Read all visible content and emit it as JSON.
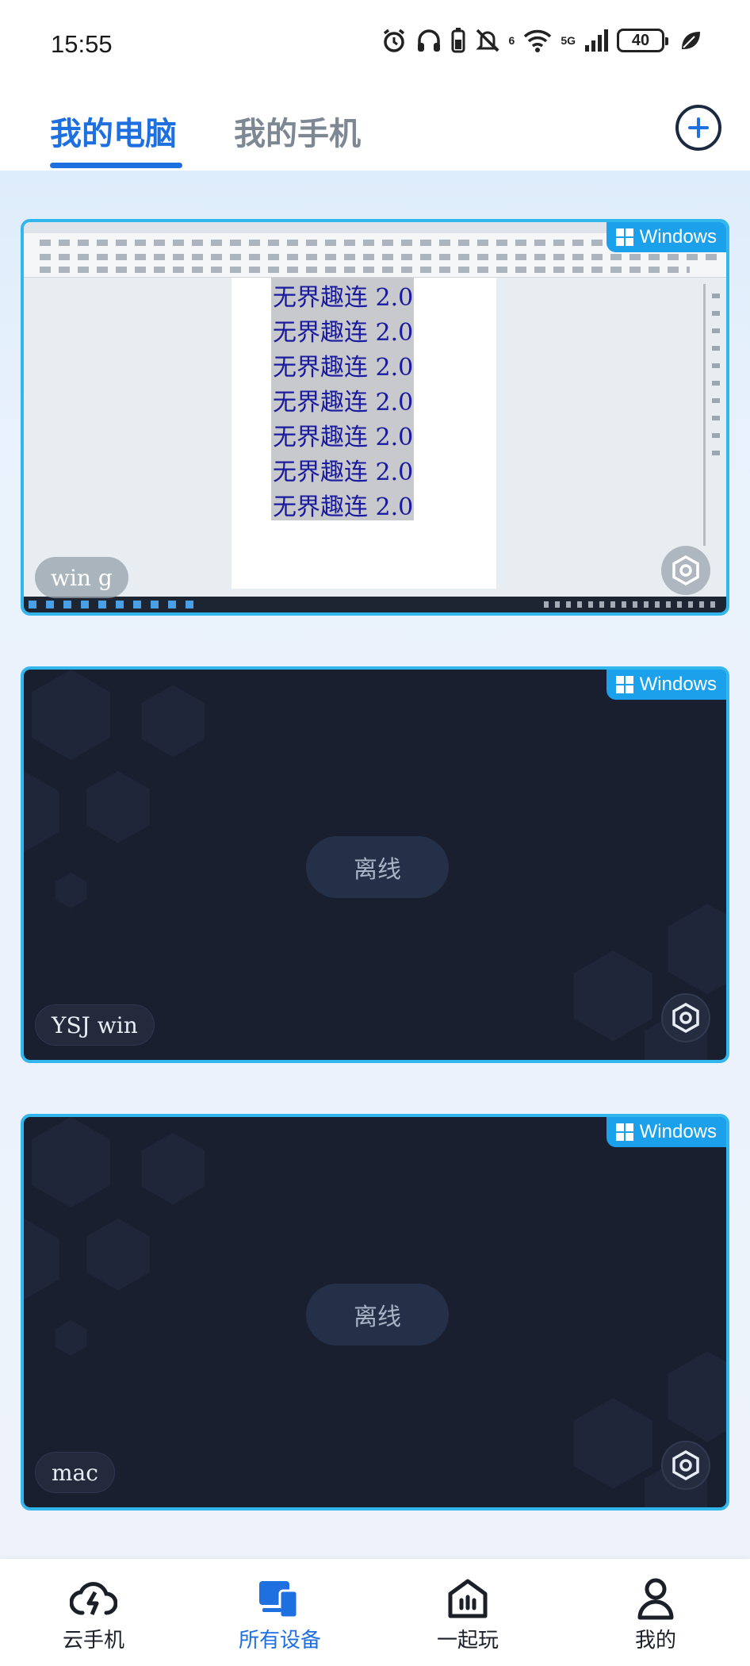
{
  "status_bar": {
    "time": "15:55",
    "signal_prefix": "6",
    "network": "5G",
    "battery": "40"
  },
  "header": {
    "tabs": [
      {
        "label": "我的电脑",
        "active": true
      },
      {
        "label": "我的手机",
        "active": false
      }
    ],
    "add_icon": "plus-circle-icon"
  },
  "devices": [
    {
      "name": "win g",
      "os": "Windows",
      "status": "online",
      "preview_lines": [
        "无界趣连 2.0",
        "无界趣连 2.0",
        "无界趣连 2.0",
        "无界趣连 2.0",
        "无界趣连 2.0",
        "无界趣连 2.0",
        "无界趣连 2.0"
      ]
    },
    {
      "name": "YSJ win",
      "os": "Windows",
      "status": "离线"
    },
    {
      "name": "mac",
      "os": "Windows",
      "status": "离线"
    }
  ],
  "bottom_nav": [
    {
      "label": "云手机",
      "icon": "cloud-lightning-icon",
      "active": false
    },
    {
      "label": "所有设备",
      "icon": "devices-icon",
      "active": true
    },
    {
      "label": "一起玩",
      "icon": "home-play-icon",
      "active": false
    },
    {
      "label": "我的",
      "icon": "person-icon",
      "active": false
    }
  ],
  "colors": {
    "accent": "#1e6fe0",
    "card_border": "#31b6ee",
    "badge": "#1ba0ec",
    "offline_card": "#1a1f30"
  }
}
